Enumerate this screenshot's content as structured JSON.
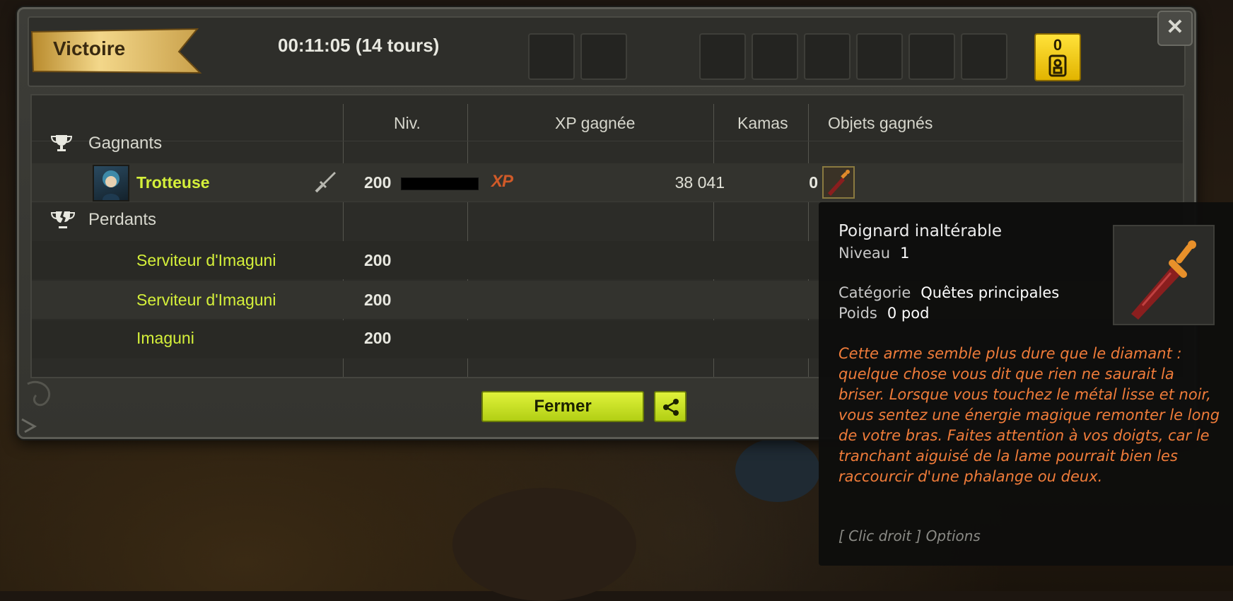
{
  "header": {
    "result_label": "Victoire",
    "duration": "00:11:05 (14 tours)",
    "chest_count": "0"
  },
  "table": {
    "columns": [
      "Niv.",
      "XP gagnée",
      "Kamas",
      "Objets gagnés"
    ],
    "winners_label": "Gagnants",
    "losers_label": "Perdants",
    "winners": [
      {
        "name": "Trotteuse",
        "level": "200",
        "xp_badge": "XP",
        "xp": "38 041",
        "kamas": "0"
      }
    ],
    "losers": [
      {
        "name": "Serviteur d'Imaguni",
        "level": "200"
      },
      {
        "name": "Serviteur d'Imaguni",
        "level": "200"
      },
      {
        "name": "Imaguni",
        "level": "200"
      }
    ]
  },
  "footer": {
    "close_label": "Fermer"
  },
  "tooltip": {
    "item_name": "Poignard inaltérable",
    "level_key": "Niveau",
    "level_value": "1",
    "category_key": "Catégorie",
    "category_value": "Quêtes principales",
    "weight_key": "Poids",
    "weight_value": "0 pod",
    "description": "Cette arme semble plus dure que le diamant : quelque chose vous dit que rien ne saurait la briser. Lorsque vous touchez le métal lisse et noir, vous sentez une énergie magique remonter le long de votre bras. Faites attention à vos doigts, car le tranchant aiguisé de la lame pourrait bien les raccourcir d'une phalange ou deux.",
    "hint": "[ Clic droit ] Options"
  },
  "colors": {
    "accent_yellow": "#d5f03a",
    "tooltip_description": "#f07c3a",
    "chest_gold": "#ffe23a"
  },
  "icons": {
    "close": "close-icon",
    "trophy": "trophy-icon",
    "broken_trophy": "broken-trophy-icon",
    "sword": "sword-icon",
    "share": "share-icon",
    "chest": "chest-icon",
    "dagger": "dagger-icon"
  }
}
